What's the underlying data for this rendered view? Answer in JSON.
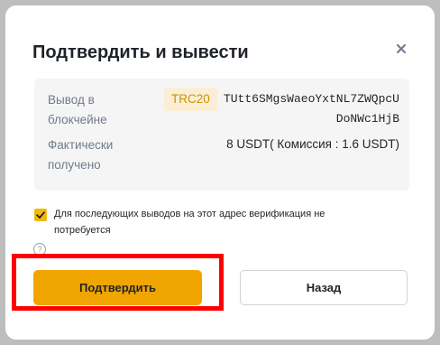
{
  "dialog": {
    "title": "Подтвердить и вывести",
    "close_icon": "close-icon"
  },
  "details": {
    "network_label": "Вывод в блокчейне",
    "network_badge": "TRC20",
    "address": "TUtt6SMgsWaeoYxtNL7ZWQpcUDoNWc1HjB",
    "received_label": "Фактически получено",
    "received_value": "8 USDT( Комиссия : 1.6 USDT)"
  },
  "verification": {
    "checked": true,
    "text": "Для последующих выводов на этот адрес верификация не потребуется",
    "help_icon": "help-circle-icon"
  },
  "buttons": {
    "confirm_label": "Подтвердить",
    "back_label": "Назад"
  },
  "colors": {
    "accent": "#f0a500",
    "badge_bg": "#fbeed5",
    "badge_text": "#c99400",
    "highlight": "#ff0000"
  }
}
